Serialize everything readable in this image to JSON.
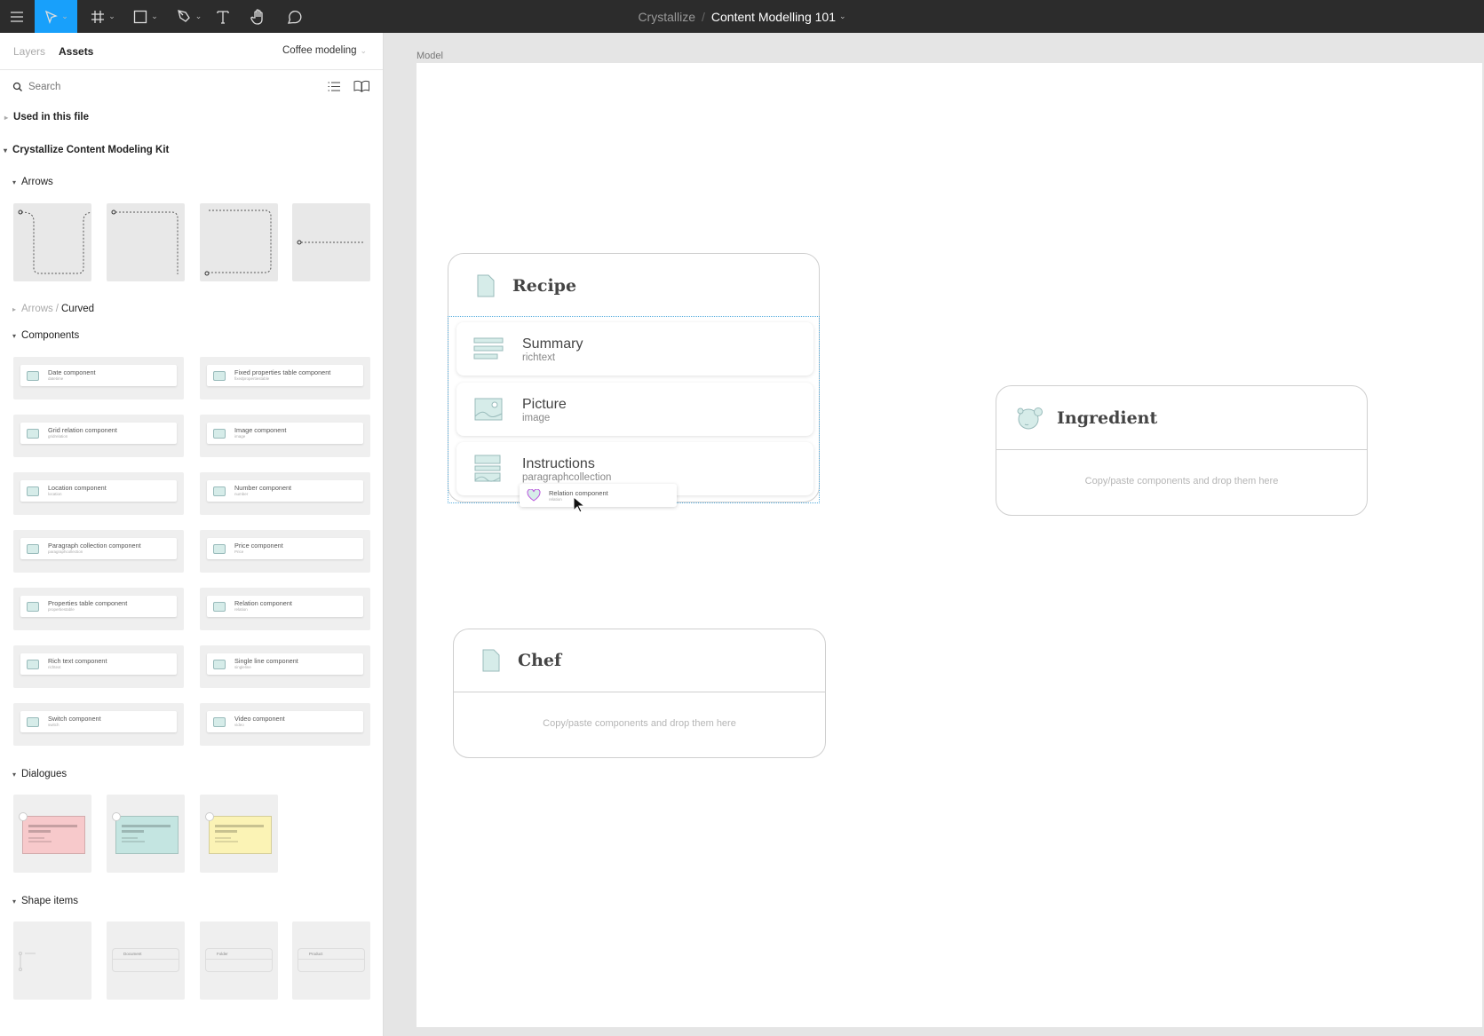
{
  "toolbar": {
    "tools": [
      "menu-icon",
      "move-icon",
      "frame-icon",
      "rectangle-icon",
      "pen-icon",
      "text-icon",
      "hand-icon",
      "comment-icon"
    ],
    "active_color": "#18a0fb"
  },
  "header": {
    "team": "Crystallize",
    "separator": "/",
    "file": "Content Modelling 101"
  },
  "sidebar": {
    "tabs": [
      "Layers",
      "Assets"
    ],
    "library": "Coffee modeling",
    "search_placeholder": "Search",
    "used_in_file": "Used in this file",
    "kit": "Crystallize Content Modeling Kit",
    "arrows": "Arrows",
    "arrows_curved_parent": "Arrows",
    "arrows_curved_sep": "/",
    "arrows_curved": "Curved",
    "components_label": "Components",
    "components": [
      {
        "name": "Date component",
        "type": "datetime"
      },
      {
        "name": "Fixed properties table component",
        "type": "fixedpropertiestable"
      },
      {
        "name": "Grid relation component",
        "type": "gridrelation"
      },
      {
        "name": "Image component",
        "type": "image"
      },
      {
        "name": "Location component",
        "type": "location"
      },
      {
        "name": "Number component",
        "type": "number"
      },
      {
        "name": "Paragraph collection component",
        "type": "paragraphcollection"
      },
      {
        "name": "Price component",
        "type": "Price"
      },
      {
        "name": "Properties table component",
        "type": "propertiestable"
      },
      {
        "name": "Relation component",
        "type": "relation"
      },
      {
        "name": "Rich text component",
        "type": "richtext"
      },
      {
        "name": "Single line component",
        "type": "singleline"
      },
      {
        "name": "Switch component",
        "type": "switch"
      },
      {
        "name": "Video component",
        "type": "video"
      }
    ],
    "dialogues": "Dialogues",
    "dialogue_colors": [
      "#f7c9cb",
      "#c4e5e1",
      "#fbf3b5"
    ],
    "shape_items": "Shape items",
    "shape_thumbs": [
      "Document",
      "Folder",
      "Product"
    ]
  },
  "canvas": {
    "frame_label": "Model",
    "recipe": {
      "title": "Recipe",
      "fields": [
        {
          "name": "Summary",
          "type": "richtext"
        },
        {
          "name": "Picture",
          "type": "image"
        },
        {
          "name": "Instructions",
          "type": "paragraphcollection"
        }
      ]
    },
    "drag_ghost": {
      "name": "Relation component",
      "type": "relation"
    },
    "ingredient": {
      "title": "Ingredient",
      "placeholder": "Copy/paste components and drop them here"
    },
    "chef": {
      "title": "Chef",
      "placeholder": "Copy/paste components and drop them here"
    },
    "accent": "#d6ece9"
  }
}
